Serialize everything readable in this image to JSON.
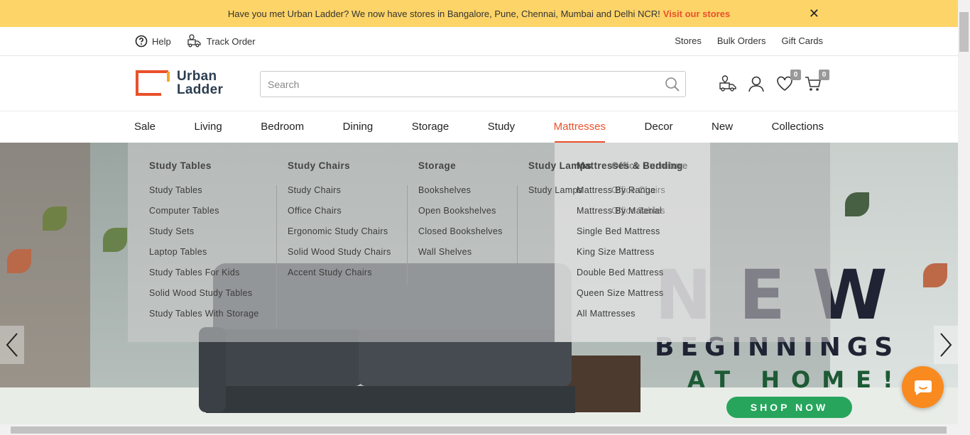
{
  "announcement": {
    "text": "Have you met Urban Ladder? We now have stores in Bangalore, Pune, Chennai, Mumbai and Delhi NCR!",
    "link": "Visit our stores",
    "close": "✕"
  },
  "utility": {
    "help": "Help",
    "track_order": "Track Order",
    "stores": "Stores",
    "bulk_orders": "Bulk Orders",
    "gift_cards": "Gift Cards"
  },
  "logo": {
    "line1": "Urban",
    "line2": "Ladder"
  },
  "search": {
    "placeholder": "Search"
  },
  "header_icons": {
    "wishlist_count": "0",
    "cart_count": "0"
  },
  "nav": {
    "items": [
      "Sale",
      "Living",
      "Bedroom",
      "Dining",
      "Storage",
      "Study",
      "Mattresses",
      "Decor",
      "New",
      "Collections"
    ],
    "active": "Mattresses"
  },
  "mega_menu": {
    "study_tables": {
      "title": "Study Tables",
      "links": [
        "Study Tables",
        "Computer Tables",
        "Study Sets",
        "Laptop Tables",
        "Study Tables For Kids",
        "Solid Wood Study Tables",
        "Study Tables With Storage"
      ]
    },
    "study_chairs": {
      "title": "Study Chairs",
      "links": [
        "Study Chairs",
        "Office Chairs",
        "Ergonomic Study Chairs",
        "Solid Wood Study Chairs",
        "Accent Study Chairs"
      ]
    },
    "storage": {
      "title": "Storage",
      "links": [
        "Bookshelves",
        "Open Bookshelves",
        "Closed Bookshelves",
        "Wall Shelves"
      ]
    },
    "study_lamps": {
      "title": "Study Lamps",
      "links": [
        "Study Lamps"
      ]
    },
    "office_furniture": {
      "title": "Office Furniture",
      "links": [
        "Office Chairs",
        "Office Tables"
      ]
    },
    "mattresses": {
      "title": "Mattresses & Bedding",
      "links": [
        "Mattress By Range",
        "Mattress By Material",
        "Single Bed Mattress",
        "King Size Mattress",
        "Double Bed Mattress",
        "Queen Size Mattress",
        "All Mattresses"
      ]
    }
  },
  "hero": {
    "headline": "NEW",
    "sub1": "BEGINNINGS",
    "sub2": "AT HOME!",
    "cta": "SHOP NOW"
  },
  "colors": {
    "accent": "#e9512b",
    "announcement_bg": "#fdd468",
    "cta_green": "#27a55c",
    "chat_orange": "#f98a1f"
  }
}
